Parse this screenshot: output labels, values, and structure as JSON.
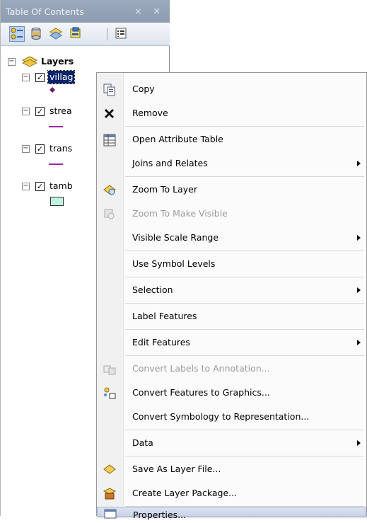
{
  "toc": {
    "title": "Table Of Contents",
    "title_buttons": "⨯ ✕",
    "root_label": "Layers",
    "layers": [
      {
        "label": "villag",
        "checked": "✓",
        "symbol": "point"
      },
      {
        "label": "strea",
        "checked": "✓",
        "symbol": "line"
      },
      {
        "label": "trans",
        "checked": "✓",
        "symbol": "line"
      },
      {
        "label": "tamb",
        "checked": "✓",
        "symbol": "polygon"
      }
    ],
    "expander": "−"
  },
  "colors": {
    "point_symbol": "#6b1e6b",
    "line_symbol": "#9a2aa8",
    "polygon_fill": "#bff2e3",
    "highlight": "#c9d4e8"
  },
  "menu": {
    "items": [
      {
        "label": "Copy",
        "icon": "copy-icon"
      },
      {
        "label": "Remove",
        "icon": "remove-icon"
      },
      {
        "label": "Open Attribute Table",
        "icon": "attribute-table-icon"
      },
      {
        "label": "Joins and Relates",
        "submenu": true
      },
      {
        "label": "Zoom To Layer",
        "icon": "zoom-to-layer-icon"
      },
      {
        "label": "Zoom To Make Visible",
        "icon": "zoom-to-make-visible-icon",
        "disabled": true
      },
      {
        "label": "Visible Scale Range",
        "submenu": true
      },
      {
        "label": "Use Symbol Levels"
      },
      {
        "label": "Selection",
        "submenu": true
      },
      {
        "label": "Label Features"
      },
      {
        "label": "Edit Features",
        "submenu": true
      },
      {
        "label": "Convert Labels to Annotation...",
        "icon": "convert-labels-icon",
        "disabled": true
      },
      {
        "label": "Convert Features to Graphics...",
        "icon": "convert-graphics-icon"
      },
      {
        "label": "Convert Symbology to Representation..."
      },
      {
        "label": "Data",
        "submenu": true
      },
      {
        "label": "Save As Layer File...",
        "icon": "layer-file-icon"
      },
      {
        "label": "Create Layer Package...",
        "icon": "layer-package-icon"
      },
      {
        "label": "Properties...",
        "icon": "properties-icon",
        "highlighted": true
      }
    ]
  }
}
